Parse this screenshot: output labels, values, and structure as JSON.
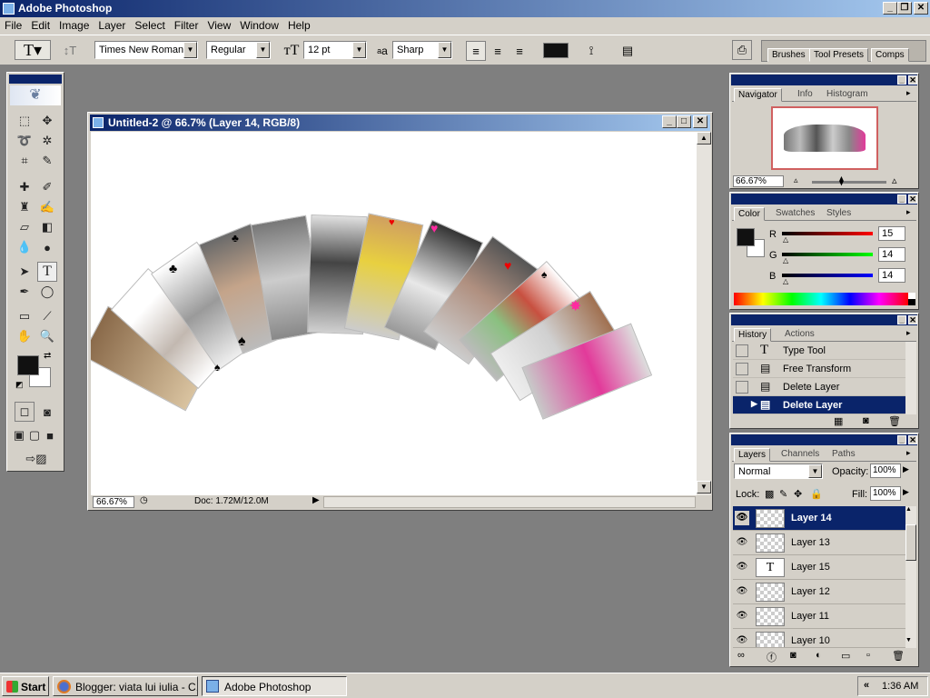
{
  "window": {
    "title": "Adobe Photoshop"
  },
  "menu": [
    "File",
    "Edit",
    "Image",
    "Layer",
    "Select",
    "Filter",
    "View",
    "Window",
    "Help"
  ],
  "options": {
    "font_family": "Times New Roman",
    "font_style": "Regular",
    "font_size": "12 pt",
    "aa_label": "a",
    "aa_sub": "a",
    "antialias": "Sharp",
    "well_tabs": [
      "Brushes",
      "Tool Presets",
      "Comps"
    ]
  },
  "document": {
    "title": "Untitled-2 @ 66.7% (Layer 14, RGB/8)",
    "zoom": "66.67%",
    "doc_info": "Doc: 1.72M/12.0M"
  },
  "navigator": {
    "tabs": [
      "Navigator",
      "Info",
      "Histogram"
    ],
    "zoom": "66.67%"
  },
  "color": {
    "tabs": [
      "Color",
      "Swatches",
      "Styles"
    ],
    "labels": [
      "R",
      "G",
      "B"
    ],
    "values": [
      "15",
      "14",
      "14"
    ]
  },
  "history": {
    "tabs": [
      "History",
      "Actions"
    ],
    "items": [
      "Type Tool",
      "Free Transform",
      "Delete Layer",
      "Delete Layer"
    ]
  },
  "layers": {
    "tabs": [
      "Layers",
      "Channels",
      "Paths"
    ],
    "mode": "Normal",
    "opacity_label": "Opacity:",
    "opacity": "100%",
    "lock_label": "Lock:",
    "fill_label": "Fill:",
    "fill": "100%",
    "items": [
      "Layer 14",
      "Layer 13",
      "Layer 15",
      "Layer 12",
      "Layer 11",
      "Layer 10"
    ],
    "text_layer_glyph": "T"
  },
  "taskbar": {
    "start": "Start",
    "tasks": [
      "Blogger: viata lui iulia - C...",
      "Adobe Photoshop"
    ],
    "clock": "1:36 AM",
    "tray_glyph": "«"
  },
  "colors": {
    "titlebar": "#0a246a",
    "chrome": "#d4d0c8",
    "workspace": "#7f7f7f",
    "accent_pink": "#ff2aa0"
  }
}
